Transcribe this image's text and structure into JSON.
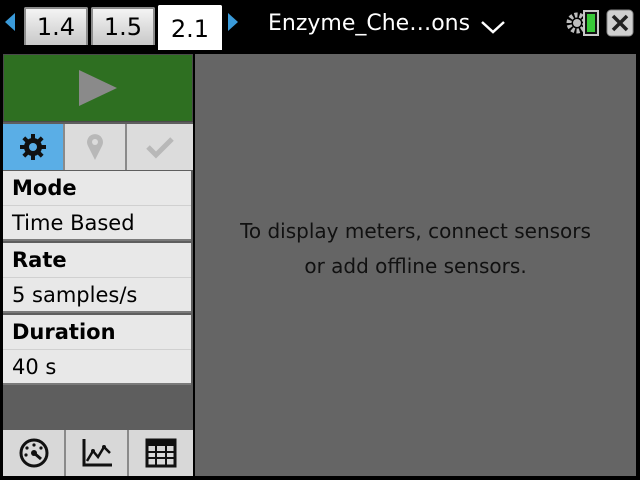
{
  "tabs": [
    {
      "label": "1.4",
      "active": false
    },
    {
      "label": "1.5",
      "active": false
    },
    {
      "label": "2.1",
      "active": true
    }
  ],
  "document": {
    "title": "Enzyme_Che…ons"
  },
  "status": {
    "battery_color": "#38c938",
    "accent": "#3a9ad9"
  },
  "toolbar": {
    "icons": [
      "gear-icon",
      "marker-icon",
      "check-icon"
    ]
  },
  "settings": {
    "mode_label": "Mode",
    "mode_value": "Time Based",
    "rate_label": "Rate",
    "rate_value": "5 samples/s",
    "duration_label": "Duration",
    "duration_value": "40 s"
  },
  "views": [
    "meter-view-icon",
    "graph-view-icon",
    "table-view-icon"
  ],
  "main": {
    "message_line1": "To display meters, connect sensors",
    "message_line2": "or add offline sensors."
  }
}
